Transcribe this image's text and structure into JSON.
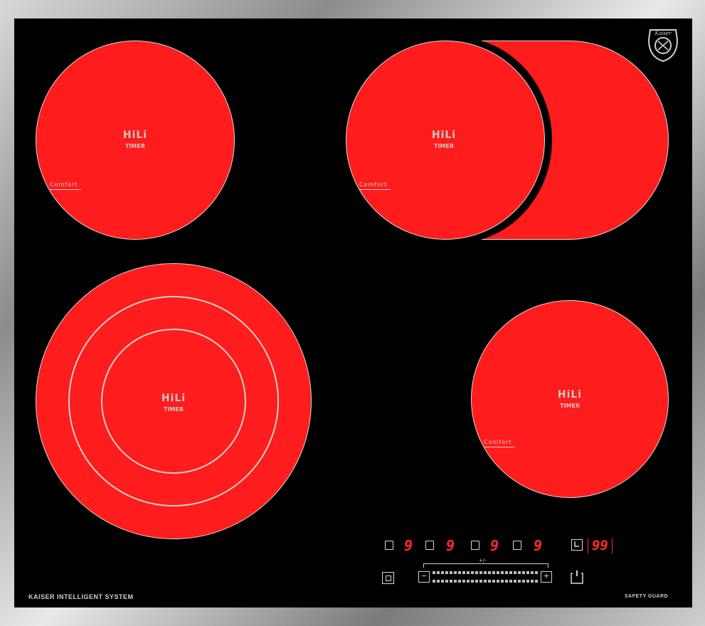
{
  "cooktop": {
    "colors": {
      "glass": "#000000",
      "zone": "#ff1c1c",
      "display": "#ff2a2a",
      "frame": "#a9a9a9"
    },
    "zones": {
      "top_left": {
        "hili": "HiLi",
        "timer": "TIMER",
        "comfort": "Comfort"
      },
      "top_right": {
        "hili": "HiLi",
        "timer": "TIMER",
        "comfort": "Comfort"
      },
      "bottom_left": {
        "hili": "HiLi",
        "timer": "TIMER"
      },
      "bottom_right": {
        "hili": "HiLi",
        "timer": "TIMER",
        "comfort": "Comfort"
      }
    },
    "controls": {
      "zone_displays": [
        "9",
        "9",
        "9",
        "9"
      ],
      "timer_display": "99",
      "slider_label": "+/-",
      "minus": "−",
      "plus": "+"
    },
    "branding": {
      "left": "KAISER INTELLIGENT SYSTEM",
      "right": "SAFETY GUARD",
      "logo_text": "Kaiser"
    }
  }
}
